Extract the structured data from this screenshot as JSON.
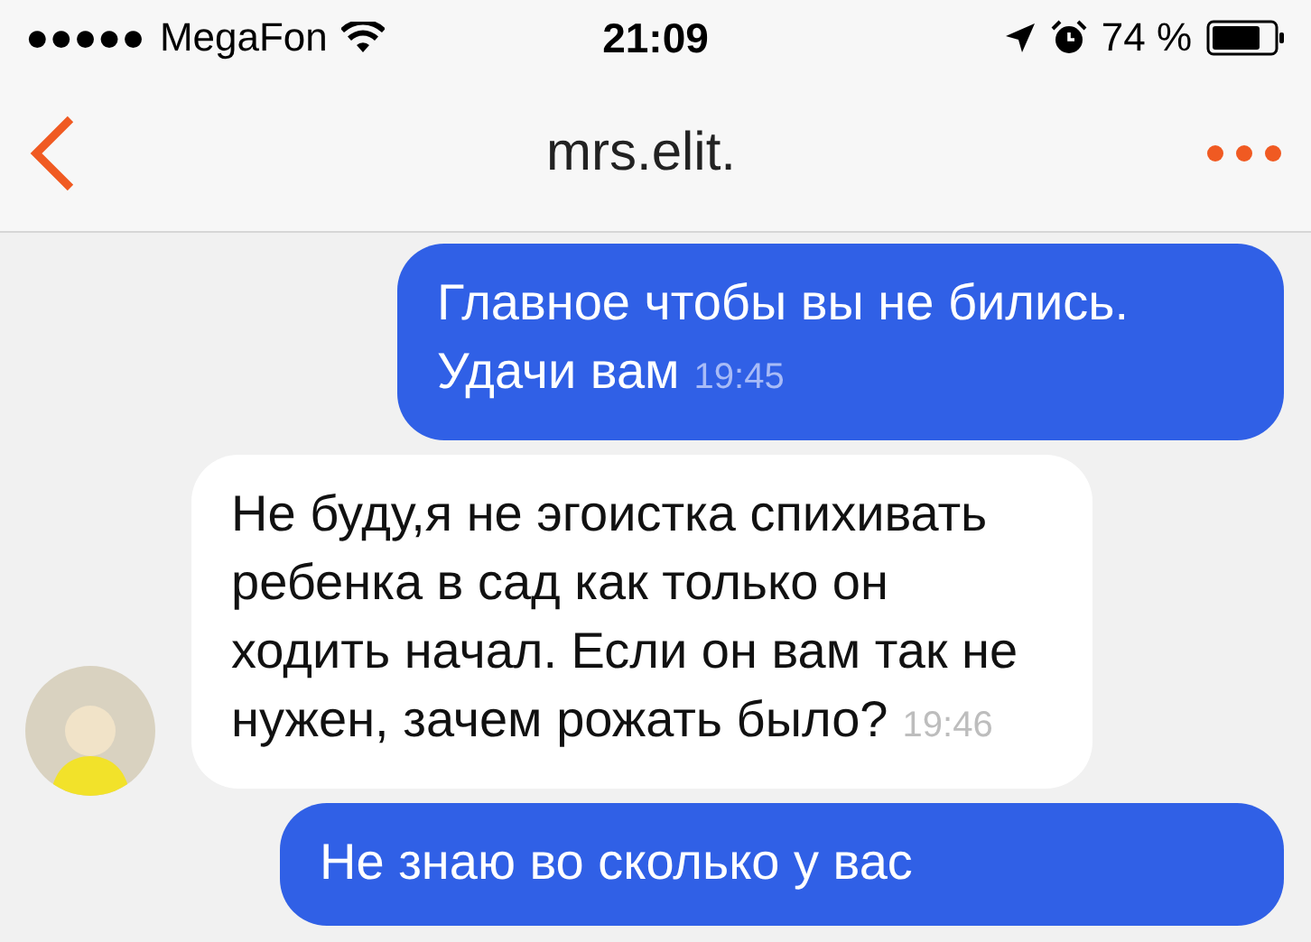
{
  "status_bar": {
    "signal": "●●●●●",
    "carrier": "MegaFon",
    "time": "21:09",
    "battery": "74 %"
  },
  "header": {
    "title": "mrs.elit."
  },
  "messages": [
    {
      "kind": "outgoing",
      "text": "Главное чтобы вы не бились. Удачи вам",
      "time": "19:45"
    },
    {
      "kind": "incoming",
      "text": "Не буду,я не эгоистка спихивать ребенка в сад как только он ходить начал. Если он вам так не нужен, зачем рожать было?",
      "time": "19:46"
    },
    {
      "kind": "outgoing",
      "text": "Не знаю во сколько у вас"
    }
  ]
}
